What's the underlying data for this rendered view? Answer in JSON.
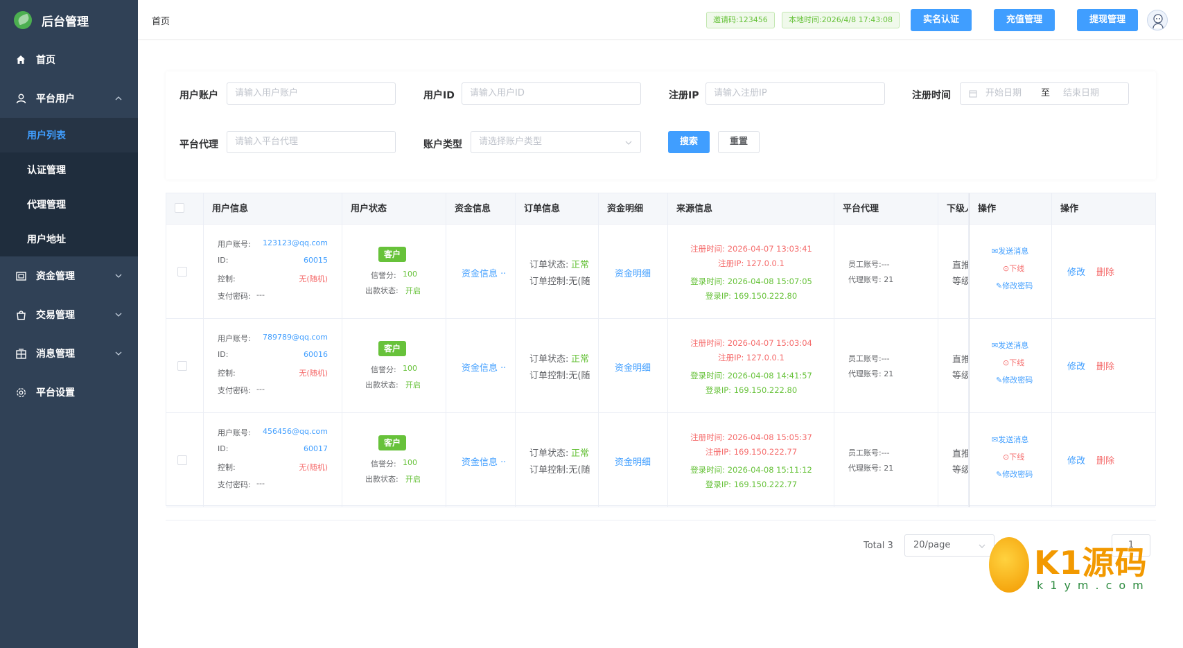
{
  "app": {
    "title": "后台管理"
  },
  "sidebar": {
    "home": "首页",
    "platform_users": "平台用户",
    "sub": [
      "用户列表",
      "认证管理",
      "代理管理",
      "用户地址"
    ],
    "funds": "资金管理",
    "trade": "交易管理",
    "messages": "消息管理",
    "settings": "平台设置"
  },
  "header": {
    "breadcrumb": "首页",
    "invite": "邀请码:123456",
    "local_time": "本地时间:2026/4/8 17:43:08",
    "btn_verify": "实名认证",
    "btn_recharge": "充值管理",
    "btn_withdraw": "提现管理"
  },
  "search": {
    "account_label": "用户账户",
    "account_placeholder": "请输入用户账户",
    "id_label": "用户ID",
    "id_placeholder": "请输入用户ID",
    "ip_label": "注册IP",
    "ip_placeholder": "请输入注册IP",
    "time_label": "注册时间",
    "start_placeholder": "开始日期",
    "range_sep": "至",
    "end_placeholder": "结束日期",
    "agent_label": "平台代理",
    "agent_placeholder": "请输入平台代理",
    "type_label": "账户类型",
    "type_placeholder": "请选择账户类型",
    "search_btn": "搜索",
    "reset_btn": "重置"
  },
  "table": {
    "headers": [
      "用户信息",
      "用户状态",
      "资金信息",
      "订单信息",
      "资金明细",
      "来源信息",
      "平台代理",
      "下级人",
      "操作",
      "操作"
    ],
    "labels": {
      "account": "用户账号:",
      "id": "ID:",
      "control": "控制:",
      "pay_pwd": "支付密码:",
      "credit": "信誉分:",
      "withdraw_state": "出款状态:",
      "order_state": "订单状态:",
      "order_control": "订单控制:无(随",
      "reg_time": "注册时间:",
      "reg_ip": "注册IP:",
      "login_time": "登录时间:",
      "login_ip": "登录IP:",
      "staff": "员工账号:",
      "agent": "代理账号:",
      "sub1": "直推",
      "sub2": "等级",
      "send_msg": "发送消息",
      "offline": "下线",
      "change_pwd": "修改密码",
      "edit": "修改",
      "delete": "删除",
      "fund_info": "资金信息 ··",
      "fund_detail": "资金明细"
    },
    "rows": [
      {
        "account": "123123@qq.com",
        "id": "60015",
        "control": "无(随机)",
        "pay_pwd": "---",
        "tag": "客户",
        "credit": "100",
        "withdraw": "开启",
        "order_state": "正常",
        "reg_time": "2026-04-07 13:03:41",
        "reg_ip": "127.0.0.1",
        "login_time": "2026-04-08 15:07:05",
        "login_ip": "169.150.222.80",
        "staff": "---",
        "agent": "21"
      },
      {
        "account": "789789@qq.com",
        "id": "60016",
        "control": "无(随机)",
        "pay_pwd": "---",
        "tag": "客户",
        "credit": "100",
        "withdraw": "开启",
        "order_state": "正常",
        "reg_time": "2026-04-07 15:03:04",
        "reg_ip": "127.0.0.1",
        "login_time": "2026-04-08 14:41:57",
        "login_ip": "169.150.222.80",
        "staff": "---",
        "agent": "21"
      },
      {
        "account": "456456@qq.com",
        "id": "60017",
        "control": "无(随机)",
        "pay_pwd": "---",
        "tag": "客户",
        "credit": "100",
        "withdraw": "开启",
        "order_state": "正常",
        "reg_time": "2026-04-08 15:05:37",
        "reg_ip": "169.150.222.77",
        "login_time": "2026-04-08 15:11:12",
        "login_ip": "169.150.222.77",
        "staff": "---",
        "agent": "21"
      }
    ]
  },
  "pager": {
    "total": "Total 3",
    "size": "20/page",
    "page": "1"
  },
  "watermark": {
    "brand": "K1源码",
    "site": "k1ym.com"
  },
  "colors": {
    "sidebar": "#304156",
    "primary": "#409eff",
    "success": "#67c23a",
    "danger": "#f56c6c"
  }
}
